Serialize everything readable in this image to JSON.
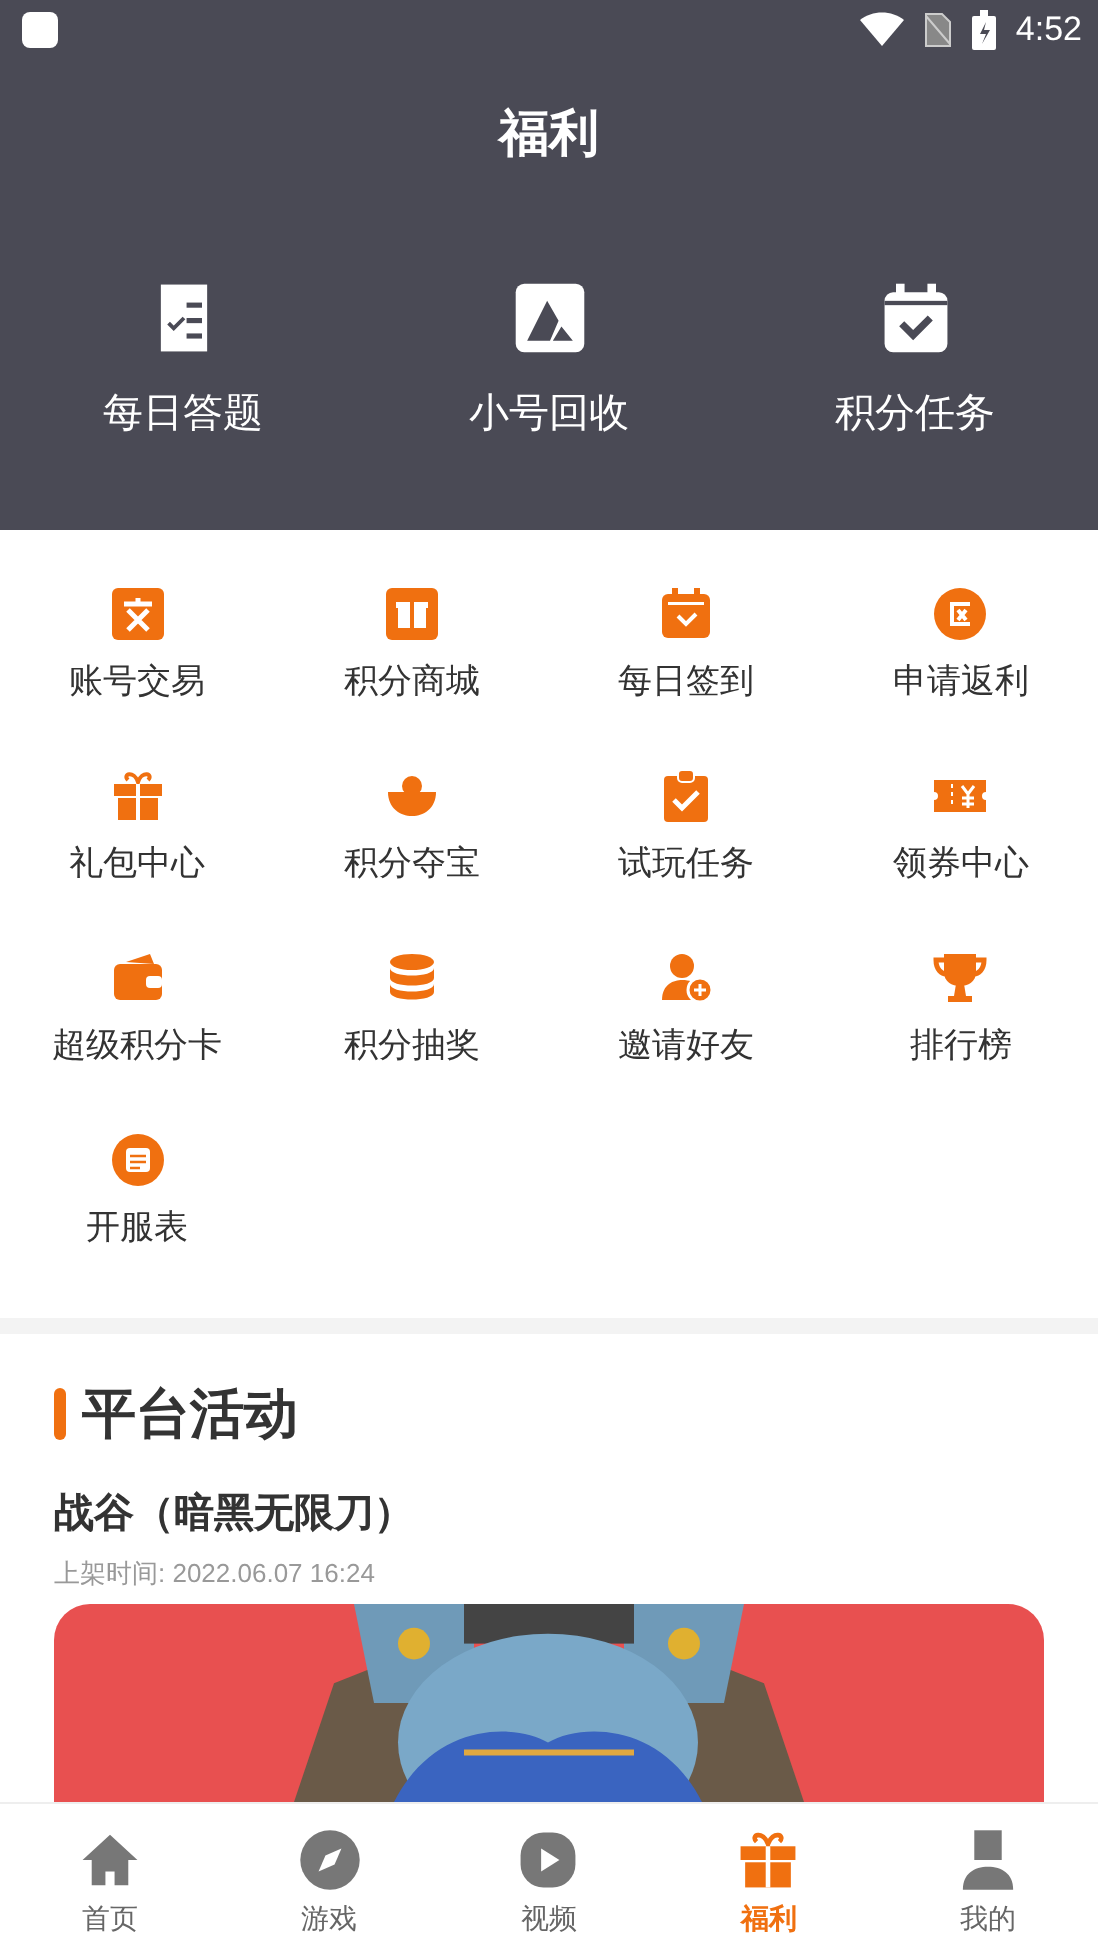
{
  "status_bar": {
    "time": "4:52"
  },
  "header": {
    "title": "福利"
  },
  "top_actions": [
    {
      "label": "每日答题"
    },
    {
      "label": "小号回收"
    },
    {
      "label": "积分任务"
    }
  ],
  "features": [
    {
      "label": "账号交易"
    },
    {
      "label": "积分商城"
    },
    {
      "label": "每日签到"
    },
    {
      "label": "申请返利"
    },
    {
      "label": "礼包中心"
    },
    {
      "label": "积分夺宝"
    },
    {
      "label": "试玩任务"
    },
    {
      "label": "领券中心"
    },
    {
      "label": "超级积分卡"
    },
    {
      "label": "积分抽奖"
    },
    {
      "label": "邀请好友"
    },
    {
      "label": "排行榜"
    },
    {
      "label": "开服表"
    }
  ],
  "activity": {
    "section_title": "平台活动",
    "game_title": "战谷（暗黑无限刀）",
    "listed_time": "上架时间: 2022.06.07 16:24"
  },
  "bottom_nav": [
    {
      "label": "首页",
      "selected": false
    },
    {
      "label": "游戏",
      "selected": false
    },
    {
      "label": "视频",
      "selected": false
    },
    {
      "label": "福利",
      "selected": true
    },
    {
      "label": "我的",
      "selected": false
    }
  ]
}
